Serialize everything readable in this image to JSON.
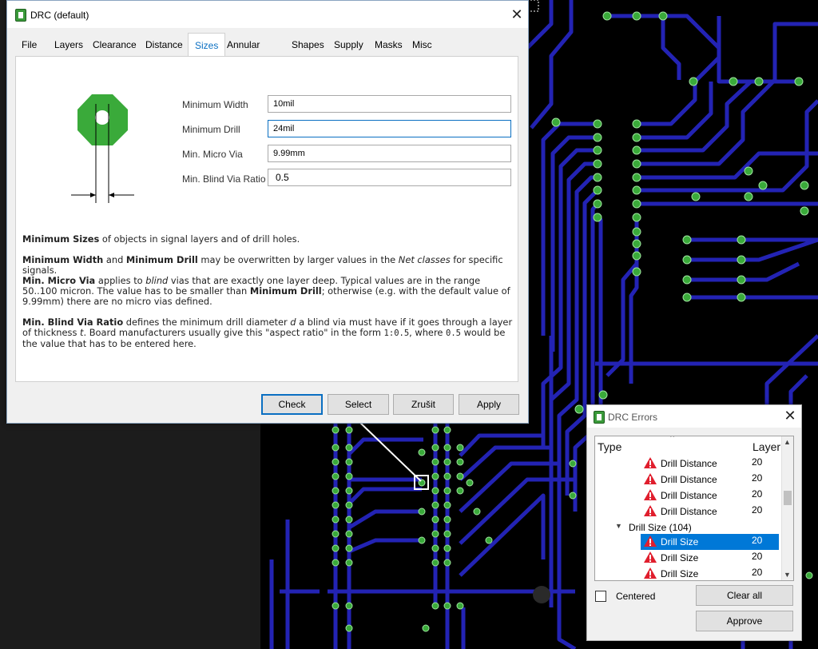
{
  "drc_dialog": {
    "title": "DRC (default)",
    "tabs": [
      "File",
      "Layers",
      "Clearance",
      "Distance",
      "Sizes",
      "Annular Ring",
      "Shapes",
      "Supply",
      "Masks",
      "Misc"
    ],
    "active_tab": "Sizes",
    "fields": [
      {
        "label": "Minimum Width",
        "value": "10mil"
      },
      {
        "label": "Minimum Drill",
        "value": "24mil"
      },
      {
        "label": "Min. Micro Via",
        "value": "9.99mm"
      },
      {
        "label": "Min. Blind Via Ratio",
        "value": "0.5"
      }
    ],
    "desc": {
      "p1_b1": "Minimum Sizes",
      "p1_t1": " of objects in signal layers and of drill holes.",
      "p2_b1": "Minimum Width",
      "p2_t1": " and ",
      "p2_b2": "Minimum Drill",
      "p2_t2": " may be overwritten by larger values in the ",
      "p2_i1": "Net classes",
      "p2_t3": " for specific signals.",
      "p3_b1": "Min. Micro Via",
      "p3_t1": " applies to ",
      "p3_i1": "blind",
      "p3_t2": " vias that are exactly one layer deep. Typical values are in the range 50..100 micron. The value has to be smaller than ",
      "p3_b2": "Minimum Drill",
      "p3_t3": "; otherwise (e.g. with the default value of 9.99mm) there are no micro vias defined.",
      "p4_b1": "Min. Blind Via Ratio",
      "p4_t1": " defines the minimum drill diameter ",
      "p4_i1": "d",
      "p4_t2": " a blind via must have if it goes through a layer of thickness ",
      "p4_i2": "t",
      "p4_t3": ". Board manufacturers usually give this \"aspect ratio\" in the form ",
      "p4_m1": "1:0.5",
      "p4_t4": ", where ",
      "p4_m2": "0.5",
      "p4_t5": " would be the value that has to be entered here."
    },
    "buttons": {
      "check": "Check",
      "select": "Select",
      "cancel": "Zrušit",
      "apply": "Apply"
    }
  },
  "drc_errors": {
    "title": "DRC Errors",
    "col_type": "Type",
    "col_layer": "Layer",
    "rows": [
      {
        "label": "Drill Distance",
        "layer": "20"
      },
      {
        "label": "Drill Distance",
        "layer": "20"
      },
      {
        "label": "Drill Distance",
        "layer": "20"
      },
      {
        "label": "Drill Distance",
        "layer": "20"
      }
    ],
    "group_label": "Drill Size (104)",
    "group_rows": [
      {
        "label": "Drill Size",
        "layer": "20",
        "selected": true
      },
      {
        "label": "Drill Size",
        "layer": "20",
        "selected": false
      },
      {
        "label": "Drill Size",
        "layer": "20",
        "selected": false
      }
    ],
    "centered_label": "Centered",
    "clear_all": "Clear all",
    "approve": "Approve"
  },
  "colors": {
    "accent": "#0a6fc2",
    "trace": "#2323b4",
    "pad": "#3aaa3a",
    "selection": "#0078d7"
  }
}
